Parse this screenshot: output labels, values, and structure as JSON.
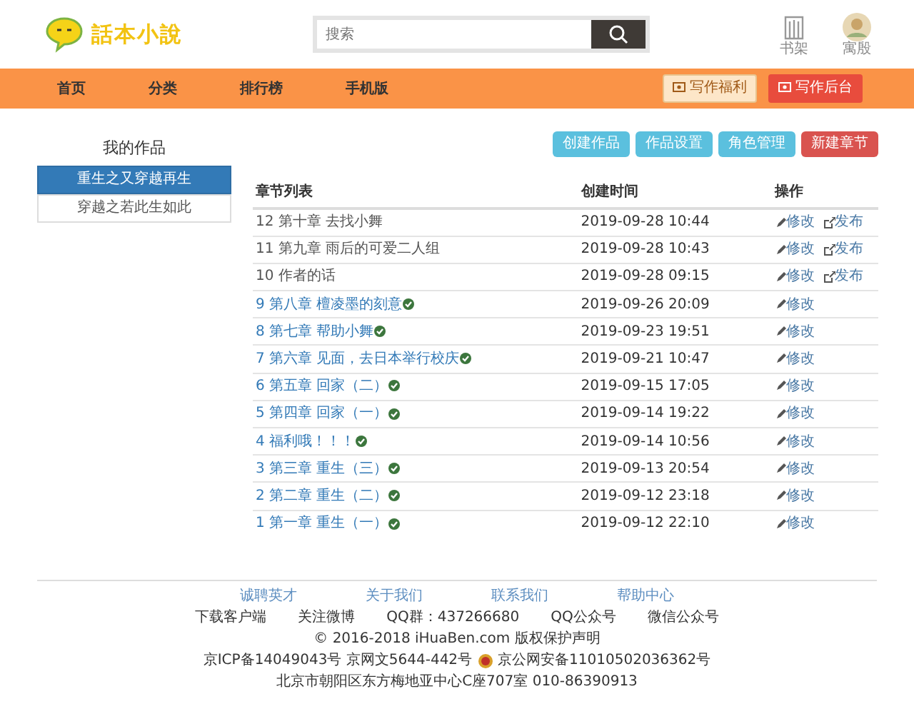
{
  "header": {
    "logo_text": "話本小說",
    "search": {
      "placeholder": "搜索"
    },
    "shortcuts": [
      {
        "kind": "shelf",
        "label": "书架"
      },
      {
        "kind": "avatar",
        "label": "寓殷"
      }
    ]
  },
  "nav": {
    "items": [
      "首页",
      "分类",
      "排行榜",
      "手机版"
    ],
    "actions": [
      {
        "kind": "welfare",
        "label": "写作福利"
      },
      {
        "kind": "backend",
        "label": "写作后台"
      }
    ]
  },
  "sidebar": {
    "title": "我的作品",
    "works": [
      {
        "title": "重生之又穿越再生",
        "selected": true
      },
      {
        "title": "穿越之若此生如此",
        "selected": false
      }
    ]
  },
  "toolbar": [
    {
      "kind": "info",
      "label": "创建作品"
    },
    {
      "kind": "info",
      "label": "作品设置"
    },
    {
      "kind": "info",
      "label": "角色管理"
    },
    {
      "kind": "danger",
      "label": "新建章节"
    }
  ],
  "table": {
    "columns": [
      "章节列表",
      "创建时间",
      "操作"
    ],
    "rows": [
      {
        "title": "12 第十章 去找小舞",
        "time": "2019-09-28 10:44",
        "published": false,
        "edit": "修改",
        "publish": "发布"
      },
      {
        "title": "11 第九章 雨后的可爱二人组",
        "time": "2019-09-28 10:43",
        "published": false,
        "edit": "修改",
        "publish": "发布"
      },
      {
        "title": "10 作者的话",
        "time": "2019-09-28 09:15",
        "published": false,
        "edit": "修改",
        "publish": "发布"
      },
      {
        "title": "9 第八章 檀凌墨的刻意",
        "time": "2019-09-26 20:09",
        "published": true,
        "edit": "修改"
      },
      {
        "title": "8 第七章 帮助小舞",
        "time": "2019-09-23 19:51",
        "published": true,
        "edit": "修改"
      },
      {
        "title": "7 第六章 见面，去日本举行校庆",
        "time": "2019-09-21 10:47",
        "published": true,
        "edit": "修改"
      },
      {
        "title": "6 第五章 回家（二）",
        "time": "2019-09-15 17:05",
        "published": true,
        "edit": "修改"
      },
      {
        "title": "5 第四章 回家（一）",
        "time": "2019-09-14 19:22",
        "published": true,
        "edit": "修改"
      },
      {
        "title": "4 福利哦！！！",
        "time": "2019-09-14 10:56",
        "published": true,
        "edit": "修改"
      },
      {
        "title": "3 第三章 重生（三）",
        "time": "2019-09-13 20:54",
        "published": true,
        "edit": "修改"
      },
      {
        "title": "2 第二章 重生（二）",
        "time": "2019-09-12 23:18",
        "published": true,
        "edit": "修改"
      },
      {
        "title": "1 第一章 重生（一）",
        "time": "2019-09-12 22:10",
        "published": true,
        "edit": "修改"
      }
    ]
  },
  "footer": {
    "links": [
      "诚聘英才",
      "关于我们",
      "联系我们",
      "帮助中心"
    ],
    "info": [
      "下载客户端",
      "关注微博",
      "QQ群：437266680",
      "QQ公众号",
      "微信公众号"
    ],
    "copyright": "© 2016-2018 iHuaBen.com 版权保护声明",
    "license": "京ICP备14049043号 京网文5644-442号",
    "police": "京公网安备11010502036362号",
    "address": "北京市朝阳区东方梅地亚中心C座707室 010-86390913"
  }
}
